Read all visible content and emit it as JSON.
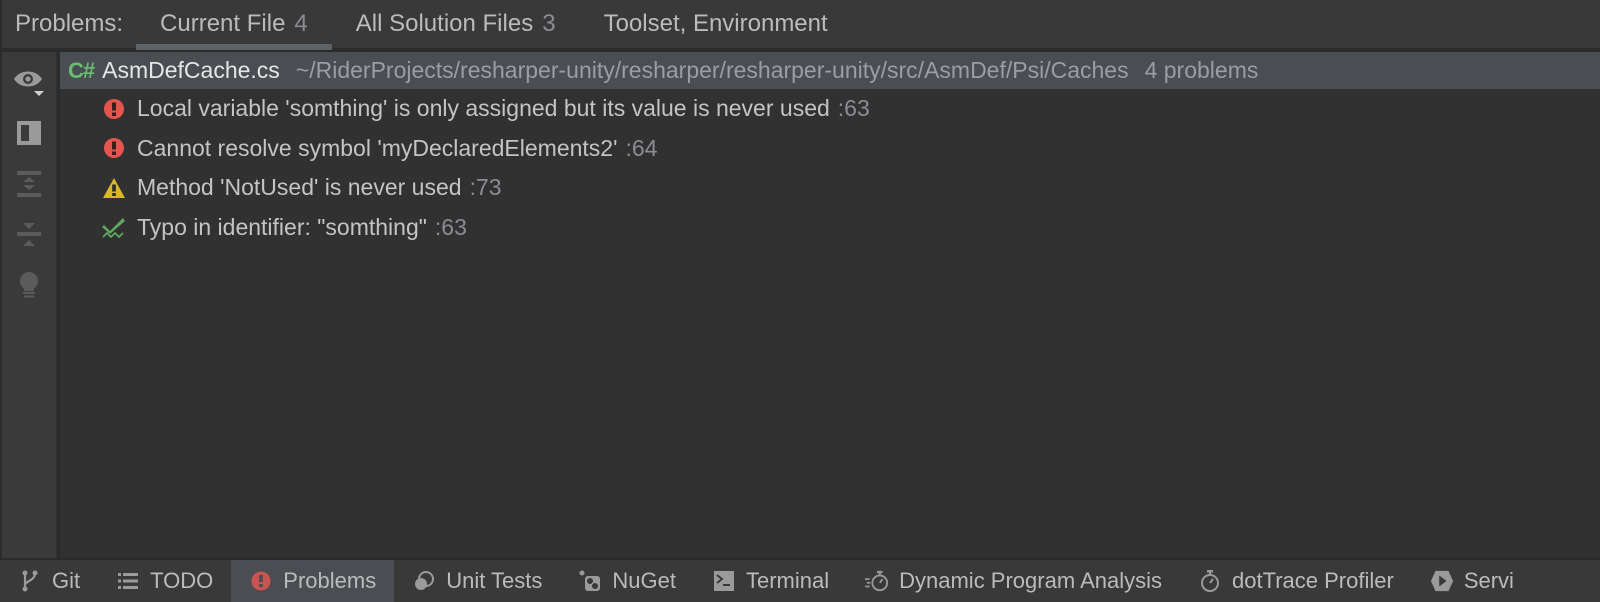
{
  "header": {
    "label": "Problems:",
    "tabs": [
      {
        "label": "Current File",
        "count": "4",
        "active": true
      },
      {
        "label": "All Solution Files",
        "count": "3",
        "active": false
      },
      {
        "label": "Toolset, Environment",
        "count": "",
        "active": false
      }
    ]
  },
  "toolbar": {
    "items": [
      {
        "icon": "eye-icon",
        "enabled": true
      },
      {
        "icon": "preview-panel-icon",
        "enabled": true
      },
      {
        "icon": "expand-all-icon",
        "enabled": false
      },
      {
        "icon": "collapse-all-icon",
        "enabled": false
      },
      {
        "icon": "lightbulb-icon",
        "enabled": false
      }
    ]
  },
  "file": {
    "lang_badge": "C#",
    "name": "AsmDefCache.cs",
    "path": "~/RiderProjects/resharper-unity/resharper/resharper-unity/src/AsmDef/Psi/Caches",
    "count": "4 problems"
  },
  "problems": [
    {
      "severity": "error",
      "icon": "error-icon",
      "text": "Local variable 'somthing' is only assigned but its value is never used",
      "line": ":63"
    },
    {
      "severity": "error",
      "icon": "error-icon",
      "text": "Cannot resolve symbol 'myDeclaredElements2'",
      "line": ":64"
    },
    {
      "severity": "warning",
      "icon": "warning-icon",
      "text": "Method 'NotUsed' is never used",
      "line": ":73"
    },
    {
      "severity": "typo",
      "icon": "typo-icon",
      "text": "Typo in identifier: \"somthing\"",
      "line": ":63"
    }
  ],
  "colors": {
    "error": "#e5554e",
    "warning": "#d9b62a",
    "typo": "#5da75f",
    "cs_badge": "#68bd6f"
  },
  "bottom": {
    "tabs": [
      {
        "label": "Git",
        "icon": "git-branch-icon",
        "active": false
      },
      {
        "label": "TODO",
        "icon": "list-icon",
        "active": false
      },
      {
        "label": "Problems",
        "icon": "problems-icon",
        "active": true
      },
      {
        "label": "Unit Tests",
        "icon": "unit-tests-icon",
        "active": false
      },
      {
        "label": "NuGet",
        "icon": "nuget-icon",
        "active": false
      },
      {
        "label": "Terminal",
        "icon": "terminal-icon",
        "active": false
      },
      {
        "label": "Dynamic Program Analysis",
        "icon": "dynamic-analysis-icon",
        "active": false
      },
      {
        "label": "dotTrace Profiler",
        "icon": "stopwatch-icon",
        "active": false
      },
      {
        "label": "Servi",
        "icon": "services-icon",
        "active": false
      }
    ]
  }
}
